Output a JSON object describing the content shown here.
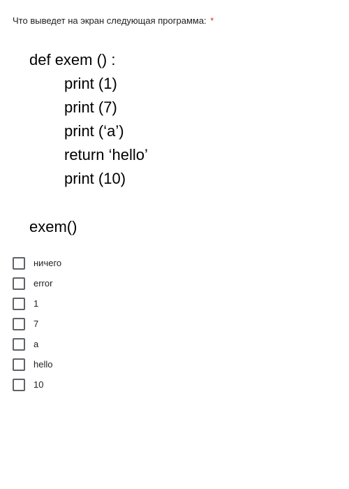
{
  "question": {
    "text": "Что выведет на экран следующая программа:",
    "required_marker": "*"
  },
  "code": {
    "lines": [
      {
        "text": "def exem () :",
        "indent": "indent1"
      },
      {
        "text": "print (1)",
        "indent": "indent2"
      },
      {
        "text": "print (7)",
        "indent": "indent2"
      },
      {
        "text": "print (‘a’)",
        "indent": "indent2"
      },
      {
        "text": "return ‘hello’",
        "indent": "indent2"
      },
      {
        "text": "print (10)",
        "indent": "indent2"
      },
      {
        "text": " ",
        "indent": "indent1"
      },
      {
        "text": "exem()",
        "indent": "indent1"
      }
    ]
  },
  "options": [
    {
      "label": "ничего"
    },
    {
      "label": "error"
    },
    {
      "label": "1"
    },
    {
      "label": "7"
    },
    {
      "label": "a"
    },
    {
      "label": "hello"
    },
    {
      "label": "10"
    }
  ]
}
